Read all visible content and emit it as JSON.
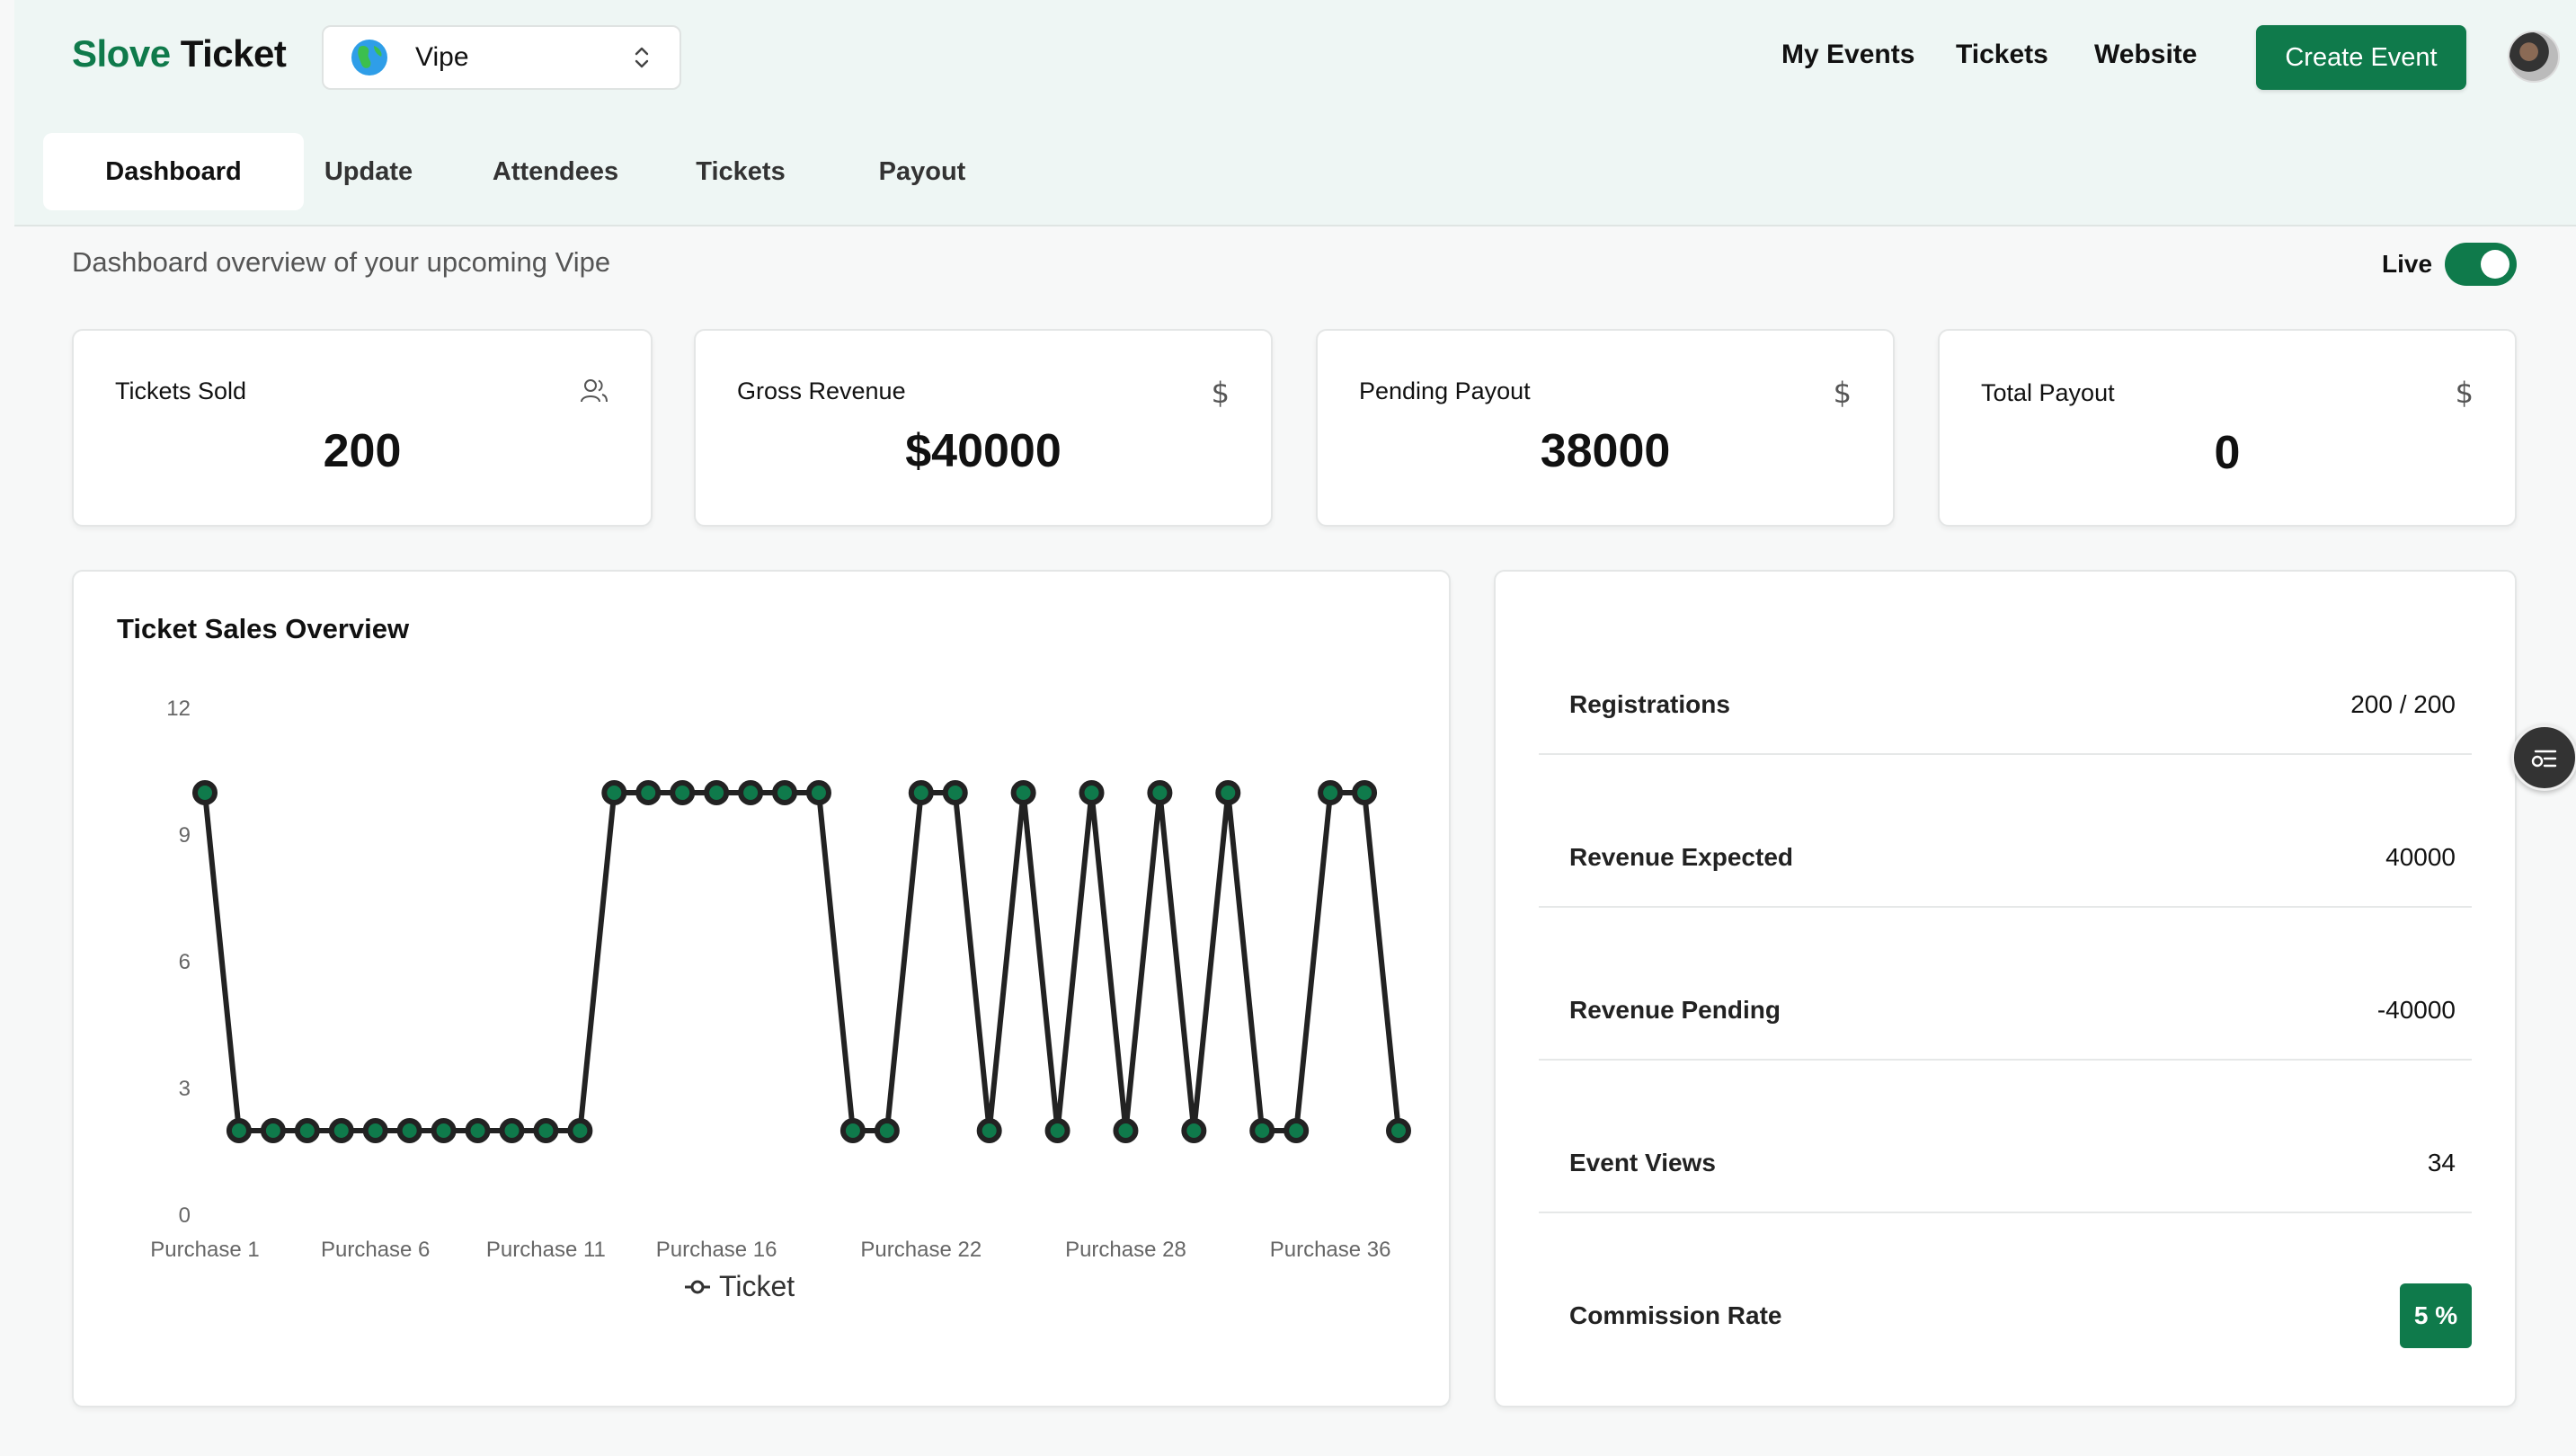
{
  "brand": {
    "part1": "Slove",
    "part2": "Ticket"
  },
  "event_select": {
    "name": "Vipe"
  },
  "top_nav": {
    "my_events": "My Events",
    "tickets": "Tickets",
    "website": "Website",
    "create_event": "Create Event"
  },
  "tabs": [
    {
      "label": "Dashboard",
      "active": true
    },
    {
      "label": "Update",
      "active": false
    },
    {
      "label": "Attendees",
      "active": false
    },
    {
      "label": "Tickets",
      "active": false
    },
    {
      "label": "Payout",
      "active": false
    }
  ],
  "subtitle": "Dashboard overview of your upcoming Vipe",
  "live": {
    "label": "Live",
    "on": true
  },
  "stats": [
    {
      "label": "Tickets Sold",
      "value": "200",
      "icon": "users-icon"
    },
    {
      "label": "Gross Revenue",
      "value": "$40000",
      "icon": "dollar-icon"
    },
    {
      "label": "Pending Payout",
      "value": "38000",
      "icon": "dollar-icon"
    },
    {
      "label": "Total Payout",
      "value": "0",
      "icon": "dollar-icon"
    }
  ],
  "chart_title": "Ticket Sales Overview",
  "chart_data": {
    "type": "line",
    "title": "Ticket Sales Overview",
    "xlabel": "",
    "ylabel": "",
    "ylim": [
      0,
      12
    ],
    "yticks": [
      "0",
      "3",
      "6",
      "9",
      "12"
    ],
    "x_tick_labels": [
      "Purchase 1",
      "Purchase 6",
      "Purchase 11",
      "Purchase 16",
      "Purchase 22",
      "Purchase 28",
      "Purchase 36"
    ],
    "x_tick_index": [
      0,
      5,
      10,
      15,
      21,
      27,
      33
    ],
    "series": [
      {
        "name": "Ticket",
        "values": [
          10,
          2,
          2,
          2,
          2,
          2,
          2,
          2,
          2,
          2,
          2,
          2,
          10,
          10,
          10,
          10,
          10,
          10,
          10,
          2,
          2,
          10,
          10,
          2,
          10,
          2,
          10,
          2,
          10,
          2,
          10,
          2,
          2,
          10,
          10,
          2
        ]
      }
    ],
    "grid": false,
    "legend_position": "bottom",
    "colors": {
      "line": "#222222",
      "marker": "#0f7a4b"
    }
  },
  "summary": [
    {
      "label": "Registrations",
      "value": "200 / 200"
    },
    {
      "label": "Revenue Expected",
      "value": "40000"
    },
    {
      "label": "Revenue Pending",
      "value": "-40000"
    },
    {
      "label": "Event Views",
      "value": "34"
    },
    {
      "label": "Commission Rate",
      "value": "5 %"
    }
  ],
  "colors": {
    "accent": "#0f7a4b",
    "header_bg": "#eef6f4"
  }
}
